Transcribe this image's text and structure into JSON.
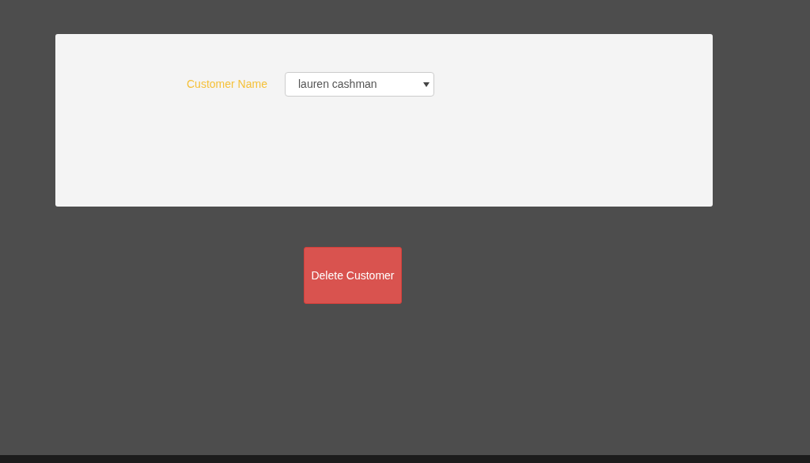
{
  "form": {
    "label": "Customer Name",
    "select": {
      "value": "lauren cashman"
    }
  },
  "button": {
    "label": "Delete Customer"
  }
}
